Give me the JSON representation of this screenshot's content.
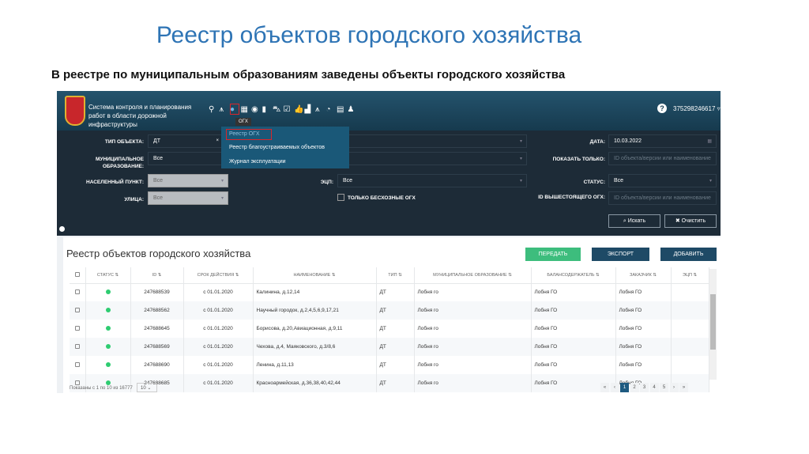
{
  "slide": {
    "title": "Реестр объектов городского хозяйства",
    "subtitle": "В реестре по муниципальным образованиям заведены объекты городского хозяйства"
  },
  "app": {
    "title": "Система контроля и планирования работ в области дорожной инфраструктуры",
    "user": "375298246617",
    "tooltip": "ОГХ",
    "toolbar_icons": [
      "map-marker-icon",
      "road-icon",
      "tree-icon",
      "calendar-icon",
      "eye-icon",
      "book-icon",
      "car-icon",
      "checklist-icon",
      "thumbs-up-icon",
      "bar-chart-icon",
      "road-icon",
      "dashboard-icon",
      "documents-icon",
      "user-icon"
    ],
    "menu": [
      "Реестр ОГХ",
      "Реестр благоустраиваемых объектов",
      "Журнал эксплуатации"
    ]
  },
  "filters": {
    "object_type_label": "ТИП ОБЪЕКТА:",
    "object_type": "ДТ",
    "municipality_label": "МУНИЦИПАЛЬНОЕ ОБРАЗОВАНИЕ:",
    "municipality": "Все",
    "locality_label": "НАСЕЛЕННЫЙ ПУНКТ:",
    "locality": "Все",
    "street_label": "УЛИЦА:",
    "street": "Все",
    "ecp_label": "ЭЦП:",
    "ecp": "Все",
    "ownerless_label": "ТОЛЬКО БЕСХОЗНЫЕ ОГХ",
    "date_label": "ДАТА:",
    "date": "10.03.2022",
    "show_only_label": "ПОКАЗАТЬ ТОЛЬКО:",
    "show_only_placeholder": "ID объекта/версии или наименование",
    "status_label": "СТАТУС:",
    "status": "Все",
    "parent_id_label": "ID ВЫШЕСТОЯЩЕГО ОГХ:",
    "parent_id_placeholder": "ID объекта/версии или наименование",
    "search": "Искать",
    "clear": "Очистить"
  },
  "registry": {
    "title": "Реестр объектов городского хозяйства",
    "transfer": "ПЕРЕДАТЬ",
    "export": "ЭКСПОРТ",
    "add": "ДОБАВИТЬ",
    "colors": {
      "transfer": "#3dbd7d",
      "export": "#1e4a66",
      "status_active": "#2ecc71"
    },
    "columns": [
      "СТАТУС",
      "ID",
      "СРОК ДЕЙСТВИЯ",
      "НАИМЕНОВАНИЕ",
      "ТИП",
      "МУНИЦИПАЛЬНОЕ ОБРАЗОВАНИЕ",
      "БАЛАНСОДЕРЖАТЕЛЬ",
      "ЗАКАЗЧИК",
      "ЭЦП"
    ],
    "rows": [
      [
        "247688539",
        "с 01.01.2020",
        "Калинина, д.12,14",
        "ДТ",
        "Лобня го",
        "Лобня ГО",
        "Лобня ГО"
      ],
      [
        "247688562",
        "с 01.01.2020",
        "Научный городок, д.2,4,5,6,9,17,21",
        "ДТ",
        "Лобня го",
        "Лобня ГО",
        "Лобня ГО"
      ],
      [
        "247688645",
        "с 01.01.2020",
        "Борисова, д.20,Авиационная, д.9,11",
        "ДТ",
        "Лобня го",
        "Лобня ГО",
        "Лобня ГО"
      ],
      [
        "247688569",
        "с 01.01.2020",
        "Чехова, д.4, Маяковского, д.3/8,6",
        "ДТ",
        "Лобня го",
        "Лобня ГО",
        "Лобня ГО"
      ],
      [
        "247688690",
        "с 01.01.2020",
        "Ленина, д.11,13",
        "ДТ",
        "Лобня го",
        "Лобня ГО",
        "Лобня ГО"
      ],
      [
        "247688685",
        "с 01.01.2020",
        "Красноармейская, д.36,38,40,42,44",
        "ДТ",
        "Лобня го",
        "Лобня ГО",
        "Лобня ГО"
      ]
    ],
    "page_info": "Показаны с 1 по 10 из 16777",
    "page_size": "10",
    "pages": [
      "«",
      "‹",
      "1",
      "2",
      "3",
      "4",
      "5",
      "›",
      "»"
    ],
    "current_page": "1"
  }
}
